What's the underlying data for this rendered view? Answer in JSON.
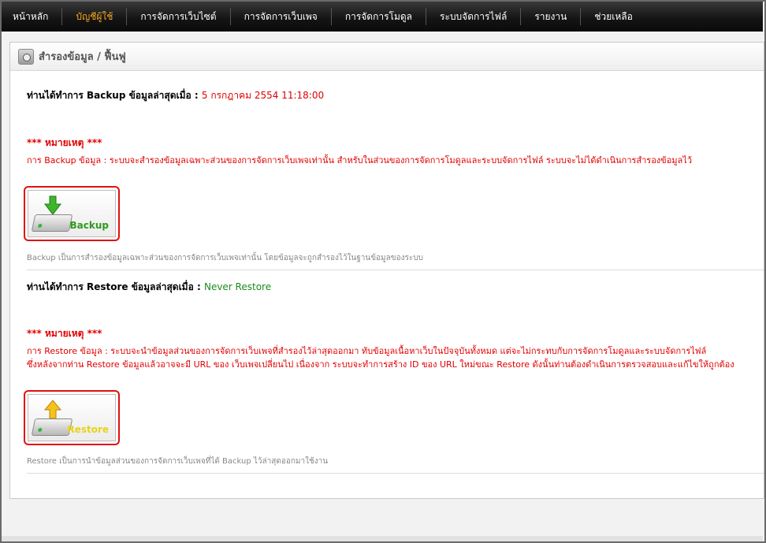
{
  "nav": {
    "items": [
      {
        "label": "หน้าหลัก",
        "active": false
      },
      {
        "label": "บัญชีผู้ใช้",
        "active": true
      },
      {
        "label": "การจัดการเว็บไซต์",
        "active": false
      },
      {
        "label": "การจัดการเว็บเพจ",
        "active": false
      },
      {
        "label": "การจัดการโมดูล",
        "active": false
      },
      {
        "label": "ระบบจัดการไฟล์",
        "active": false
      },
      {
        "label": "รายงาน",
        "active": false
      },
      {
        "label": "ช่วยเหลือ",
        "active": false
      }
    ]
  },
  "panel": {
    "title": "สำรองข้อมูล / ฟื้นฟู",
    "header_icon": "backup-drive-icon"
  },
  "backup": {
    "status_label": "ท่านได้ทำการ Backup ข้อมูลล่าสุดเมื่อ :",
    "status_value": "5 กรกฎาคม 2554 11:18:00",
    "note_title": "*** หมายเหตุ ***",
    "note_text": "การ Backup ข้อมูล : ระบบจะสำรองข้อมูลเฉพาะส่วนของการจัดการเว็บเพจเท่านั้น สำหรับในส่วนของการจัดการโมดูลและระบบจัดการไฟล์ ระบบจะไม่ได้ดำเนินการสำรองข้อมูลไว้",
    "button_label": "Backup",
    "button_icon": "download-arrow-icon",
    "description": "Backup เป็นการสำรองข้อมูลเฉพาะส่วนของการจัดการเว็บเพจเท่านั้น โดยข้อมูลจะถูกสำรองไว้ในฐานข้อมูลของระบบ",
    "label_color": "#2e9a1e"
  },
  "restore": {
    "status_label": "ท่านได้ทำการ Restore ข้อมูลล่าสุดเมื่อ :",
    "status_value": "Never Restore",
    "note_title": "*** หมายเหตุ ***",
    "note_line1": "การ Restore ข้อมูล : ระบบจะนำข้อมูลส่วนของการจัดการเว็บเพจที่สำรองไว้ล่าสุดออกมา ทับข้อมูลเนื้อหาเว็บในปัจจุบันทั้งหมด แต่จะไม่กระทบกับการจัดการโมดูลและระบบจัดการไฟล์",
    "note_line2": "ซึ่งหลังจากท่าน Restore ข้อมูลแล้วอาจจะมี URL ของ เว็บเพจเปลี่ยนไป เนื่องจาก ระบบจะทำการสร้าง ID ของ URL ใหม่ขณะ Restore ดังนั้นท่านต้องดำเนินการตรวจสอบและแก้ไขให้ถูกต้อง",
    "button_label": "Restore",
    "button_icon": "upload-arrow-icon",
    "description": "Restore เป็นการนำข้อมูลส่วนของการจัดการเว็บเพจที่ได้ Backup ไว้ล่าสุดออกมาใช้งาน",
    "label_color": "#e8d21a"
  }
}
